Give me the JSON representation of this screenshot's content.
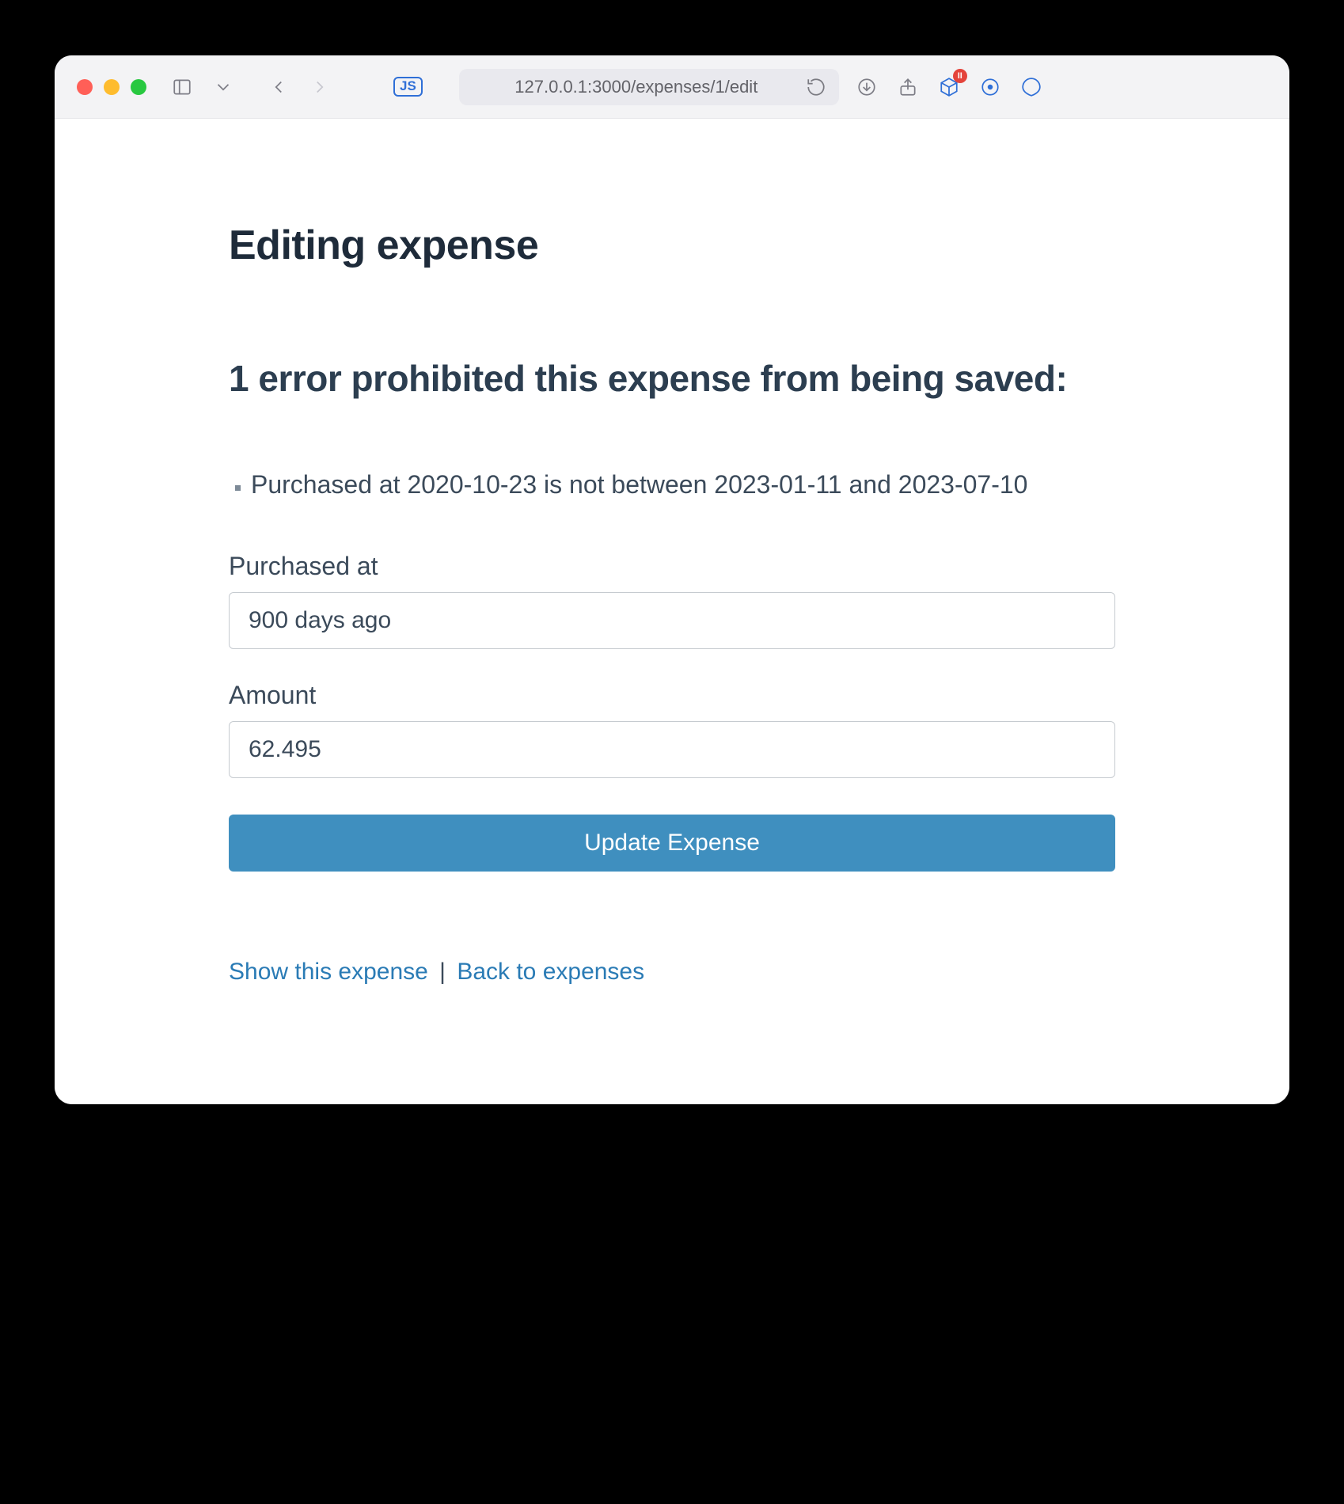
{
  "browser": {
    "url": "127.0.0.1:3000/expenses/1/edit",
    "js_badge": "JS",
    "ext_badge_text": "II"
  },
  "page": {
    "title": "Editing expense",
    "error_heading": "1 error prohibited this expense from being saved:",
    "errors": [
      "Purchased at 2020-10-23 is not between 2023-01-11 and 2023-07-10"
    ],
    "fields": {
      "purchased_at": {
        "label": "Purchased at",
        "value": "900 days ago"
      },
      "amount": {
        "label": "Amount",
        "value": "62.495"
      }
    },
    "submit_label": "Update Expense",
    "links": {
      "show": "Show this expense",
      "back": "Back to expenses",
      "separator": "|"
    }
  }
}
